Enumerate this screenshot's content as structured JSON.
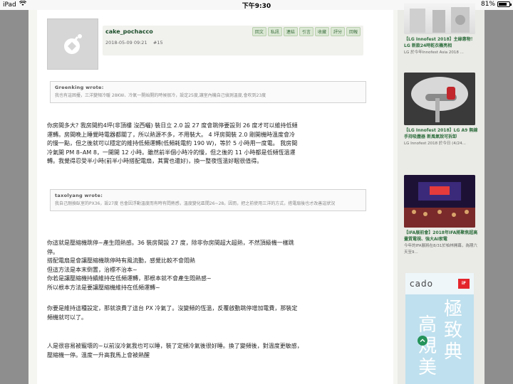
{
  "status_bar": {
    "device": "iPad",
    "time": "下午9:30",
    "battery": "81%",
    "battery_level": 0.81
  },
  "post": {
    "username": "cake_pochacco",
    "date": "2018-05-09 09:21",
    "floor": "#15",
    "actions": [
      "回文",
      "私訊",
      "連結",
      "引言",
      "收藏",
      "評分",
      "回報"
    ],
    "quote1": {
      "author": "Greenking wrote:",
      "text": "我也有這困擾，三洋變頻冷暖 28KW、冷氣一開始開的時候很冷，設定25度,讓室內機自己偵測溫度,會吹到23度"
    },
    "paragraph1": [
      "你房間多大? 我房間約4坪(非頂樓 沒西曬) 裝日立 2.0 設 27 度會跳停要設到 26 度才可以維持低頻",
      "運轉。房間晚上睡覺時電器都關了，所以熱源不多，不用裝大。 4 坪房間裝 2.0 剛開機時溫度會冷",
      "的慢一點，但之後就可以穩定的維持低頻運轉(低頻耗電約 190 W)，等於 5 小時用一度電。 我房間",
      "冷氣開 PM 8–AM 8，一開開 12 小時。雖然前半個小時冷的慢，但之後的 11 小時都是低頻恆溫運",
      "轉。我覺得忍受半小時(前半小時搭配電扇，其實也還好)，換一整夜恆溫好眠很值得。"
    ],
    "quote2": {
      "author": "taxolyang wrote:",
      "text": "我自己剛換臥室的PX36，設27度 也會因浮動溫度而有時有悶熱感，溫度變化區間26~28。因而，把之前使用三洋的方式，搭電扇後也才改善這狀況"
    },
    "paragraph2": [
      "你這就是壓縮機跳停~產生悶熱感。36 裝房間設 27 度，除非你房間超大超熱，不然頂級機一樣跳",
      "停。",
      "搭配電扇是會讓壓縮機跳停時有風流動，感覺比較不會悶熱",
      "但這方法是本末倒置，治標不治本~",
      "你若是讓壓縮機持續維持在低頻運轉，那根本就不會產生悶熱感~",
      "所以根本方法是要讓壓縮機維持在低頻運轉~"
    ],
    "paragraph3": [
      "你要是維持這種設定，那就浪費了這台 PX 冷氣了。沒變頻的恆溫，反覆啟動跳停增加電費，那裝定",
      "頻機就可以了。"
    ],
    "paragraph4": [
      "人是很容易被寵壞的~以前沒冷氣我也可以睡，裝了定頻冷氣後很好睡。換了變頻後，對溫度更敏感，",
      "壓縮機一停。溫度一升高我馬上會被熱醒"
    ]
  },
  "sidebar": {
    "cards": [
      {
        "title": "【LG Innofest 2018】主綠惠物！LG 新款24時乾衣機亮相",
        "meta": "LG 於今年Innofest Asia 2018 ..."
      },
      {
        "title": "【LG Innofest 2018】LG A9 無線手持吸塵器 新風氣說可拆卸",
        "meta": "LG Innofest 2018 於今日 (4/24..."
      },
      {
        "title": "【IFA展前會】2018年IFA將聚焦超高畫質電視、強大AI家電",
        "meta": "今年的IFA展將在8/31於柏林開幕，為期六天至9..."
      }
    ],
    "ad": {
      "logo": "cado",
      "badge": "iF",
      "col1": [
        "高",
        "規",
        "美"
      ],
      "col2": [
        "極",
        "致",
        "典"
      ]
    }
  },
  "colors": {
    "username": "#1c4e2a",
    "sidebar_title": "#2f6f3e",
    "float_button": "#25935a"
  }
}
